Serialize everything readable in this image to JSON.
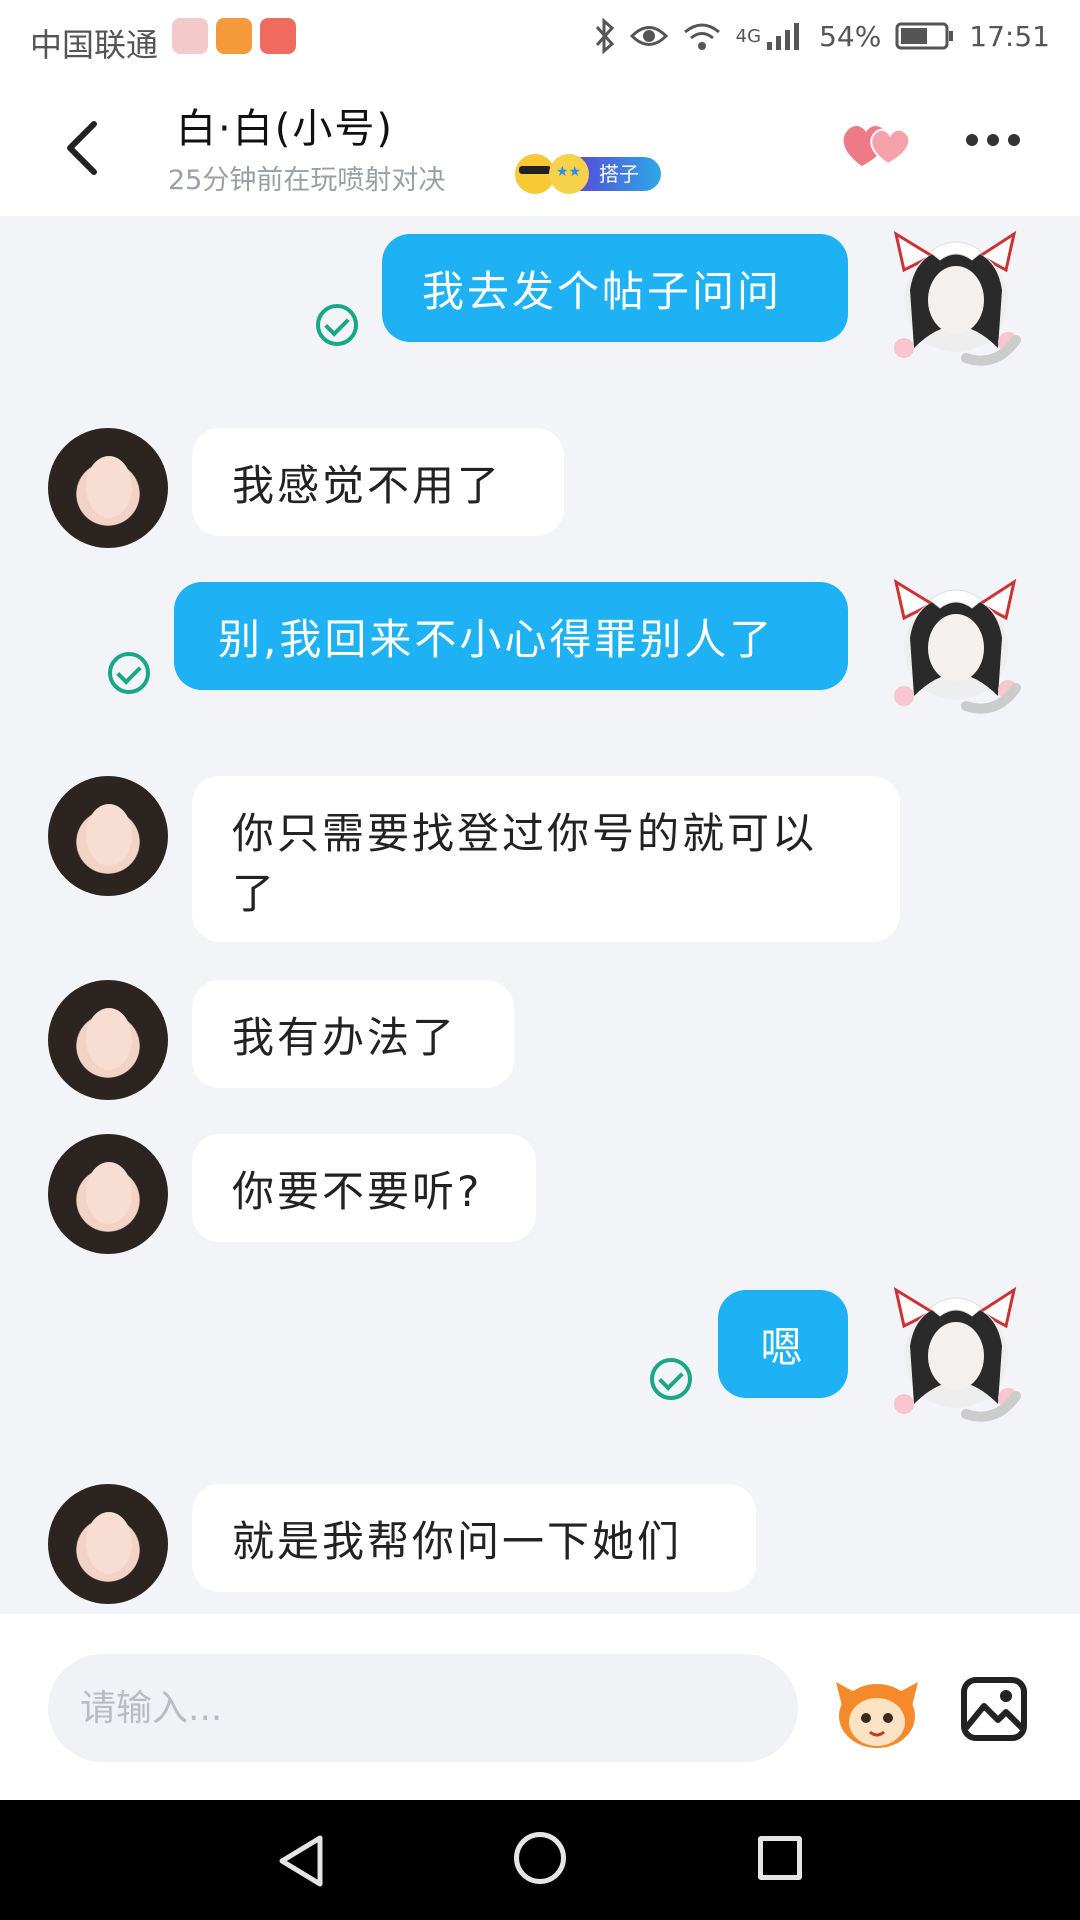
{
  "status_bar": {
    "carrier": "中国联通",
    "signal_type": "4G",
    "battery": "54%",
    "time": "17:51",
    "icons": [
      "bluetooth-icon",
      "eye-icon",
      "wifi-icon",
      "signal-icon",
      "battery-icon"
    ]
  },
  "header": {
    "title": "白·白(小号)",
    "subtitle": "25分钟前在玩喷射对决",
    "badge_label": "搭子",
    "accent_color": "#ef7a87"
  },
  "messages": [
    {
      "from": "self",
      "text": "我去发个帖子问问",
      "status": "sent"
    },
    {
      "from": "other",
      "text": "我感觉不用了"
    },
    {
      "from": "self",
      "text": "别,我回来不小心得罪别人了",
      "status": "sent"
    },
    {
      "from": "other",
      "text": "你只需要找登过你号的就可以了"
    },
    {
      "from": "other",
      "text": "我有办法了"
    },
    {
      "from": "other",
      "text": "你要不要听?"
    },
    {
      "from": "self",
      "text": "嗯",
      "status": "sent"
    },
    {
      "from": "other",
      "text": "就是我帮你问一下她们"
    }
  ],
  "input": {
    "placeholder": "请输入..."
  },
  "colors": {
    "self_bubble": "#1eb2f5",
    "other_bubble": "#ffffff",
    "check": "#1aa784",
    "background": "#f3f4f8"
  }
}
